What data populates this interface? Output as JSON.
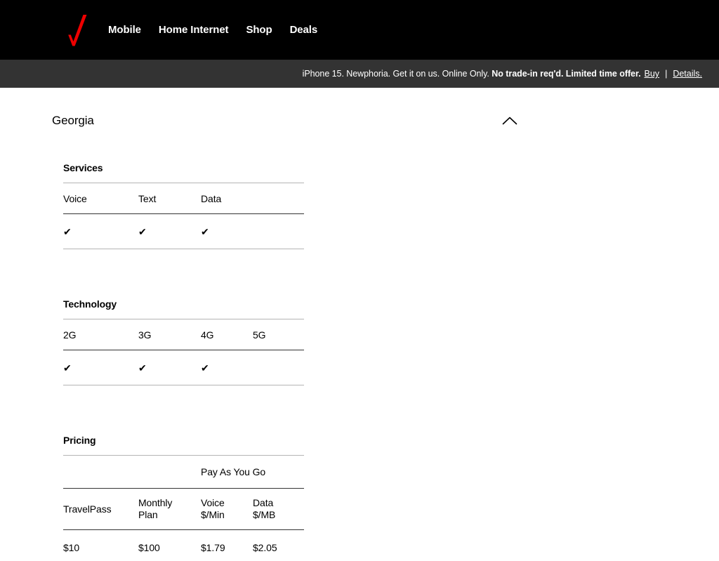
{
  "header": {
    "logo_name": "verizon-checkmark-logo",
    "logo_color": "#ee0000",
    "background": "#000000",
    "nav": [
      {
        "label": "Mobile"
      },
      {
        "label": "Home Internet"
      },
      {
        "label": "Shop"
      },
      {
        "label": "Deals"
      }
    ]
  },
  "promo": {
    "background": "#333333",
    "text_plain": "iPhone 15. Newphoria. Get it on us. Online Only. ",
    "text_bold": "No trade-in req'd. Limited time offer.",
    "buy_link": "Buy",
    "separator": "|",
    "details_link": "Details."
  },
  "region": {
    "name": "Georgia",
    "collapse_icon": "chevron-up-icon"
  },
  "sections": [
    {
      "id": "services",
      "title": "Services",
      "columns": [
        "Voice",
        "Text",
        "Data"
      ],
      "values": [
        "✔",
        "✔",
        "✔"
      ]
    },
    {
      "id": "technology",
      "title": "Technology",
      "columns": [
        "2G",
        "3G",
        "4G",
        "5G"
      ],
      "values": [
        "✔",
        "✔",
        "✔",
        ""
      ]
    }
  ],
  "pricing": {
    "title": "Pricing",
    "group_header": {
      "blank_1": "",
      "blank_2": "",
      "label": "Pay As You Go"
    },
    "columns": [
      {
        "line1": "TravelPass",
        "line2": ""
      },
      {
        "line1": "Monthly",
        "line2": "Plan"
      },
      {
        "line1": "Voice",
        "line2": "$/Min"
      },
      {
        "line1": "Data",
        "line2": "$/MB"
      }
    ],
    "values": [
      "$10",
      "$100",
      "$1.79",
      "$2.05"
    ]
  }
}
